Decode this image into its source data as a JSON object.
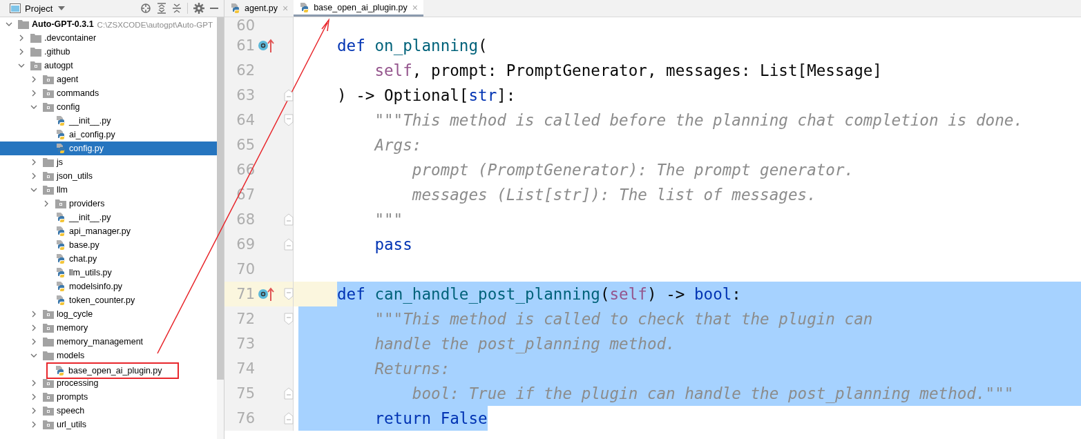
{
  "sidebar": {
    "title": "Project",
    "tree": [
      {
        "kind": "folder",
        "name": "Auto-GPT-0.3.1",
        "path": "C:\\ZSXCODE\\autogpt\\Auto-GPT",
        "expanded": true,
        "selected": false,
        "children": [
          {
            "kind": "folder",
            "name": ".devcontainer",
            "expanded": false,
            "selected": false
          },
          {
            "kind": "folder",
            "name": ".github",
            "expanded": false,
            "selected": false
          },
          {
            "kind": "package",
            "name": "autogpt",
            "expanded": true,
            "selected": false,
            "children": [
              {
                "kind": "package",
                "name": "agent",
                "expanded": false,
                "selected": false
              },
              {
                "kind": "package",
                "name": "commands",
                "expanded": false,
                "selected": false
              },
              {
                "kind": "package",
                "name": "config",
                "expanded": true,
                "selected": false,
                "children": [
                  {
                    "kind": "python",
                    "name": "__init__.py",
                    "selected": false
                  },
                  {
                    "kind": "python",
                    "name": "ai_config.py",
                    "selected": false
                  },
                  {
                    "kind": "python",
                    "name": "config.py",
                    "selected": true
                  }
                ]
              },
              {
                "kind": "folder",
                "name": "js",
                "expanded": false,
                "selected": false
              },
              {
                "kind": "package",
                "name": "json_utils",
                "expanded": false,
                "selected": false
              },
              {
                "kind": "package",
                "name": "llm",
                "expanded": true,
                "selected": false,
                "children": [
                  {
                    "kind": "package",
                    "name": "providers",
                    "expanded": false,
                    "selected": false
                  },
                  {
                    "kind": "python",
                    "name": "__init__.py",
                    "selected": false
                  },
                  {
                    "kind": "python",
                    "name": "api_manager.py",
                    "selected": false
                  },
                  {
                    "kind": "python",
                    "name": "base.py",
                    "selected": false
                  },
                  {
                    "kind": "python",
                    "name": "chat.py",
                    "selected": false
                  },
                  {
                    "kind": "python",
                    "name": "llm_utils.py",
                    "selected": false
                  },
                  {
                    "kind": "python",
                    "name": "modelsinfo.py",
                    "selected": false
                  },
                  {
                    "kind": "python",
                    "name": "token_counter.py",
                    "selected": false
                  }
                ]
              },
              {
                "kind": "package",
                "name": "log_cycle",
                "expanded": false,
                "selected": false
              },
              {
                "kind": "package",
                "name": "memory",
                "expanded": false,
                "selected": false
              },
              {
                "kind": "folder",
                "name": "memory_management",
                "expanded": false,
                "selected": false
              },
              {
                "kind": "folder",
                "name": "models",
                "expanded": true,
                "selected": false,
                "children": [
                  {
                    "kind": "python",
                    "name": "base_open_ai_plugin.py",
                    "selected": false,
                    "boxed": true
                  }
                ]
              },
              {
                "kind": "package",
                "name": "processing",
                "expanded": false,
                "selected": false
              },
              {
                "kind": "package",
                "name": "prompts",
                "expanded": false,
                "selected": false
              },
              {
                "kind": "package",
                "name": "speech",
                "expanded": false,
                "selected": false
              },
              {
                "kind": "package",
                "name": "url_utils",
                "expanded": false,
                "selected": false
              }
            ]
          }
        ]
      }
    ]
  },
  "tabs": [
    {
      "label": "agent.py",
      "close": "×",
      "selected": false
    },
    {
      "label": "base_open_ai_plugin.py",
      "close": "×",
      "selected": true
    }
  ],
  "annotation_arrow": true,
  "editor": {
    "lines": [
      {
        "number": "60",
        "selected": false,
        "current": false,
        "override": false,
        "fold_start": false,
        "fold_end": false
      },
      {
        "number": "61",
        "selected": false,
        "current": false,
        "override": true,
        "fold_start": false,
        "fold_end": false,
        "tokens": [
          {
            "kind": "kw",
            "text": "def "
          },
          {
            "kind": "fn",
            "text": "on_planning"
          },
          {
            "kind": "plain",
            "text": "("
          }
        ]
      },
      {
        "number": "62",
        "selected": false,
        "current": false,
        "override": false,
        "fold_start": false,
        "fold_end": false,
        "tokens": [
          {
            "kind": "self",
            "text": "    self"
          },
          {
            "kind": "plain",
            "text": ", prompt: PromptGenerator, messages: List[Message]"
          }
        ]
      },
      {
        "number": "63",
        "selected": false,
        "current": false,
        "override": false,
        "fold_start": false,
        "fold_end": true,
        "tokens": [
          {
            "kind": "plain",
            "text": ") -> Optional["
          },
          {
            "kind": "builtin",
            "text": "str"
          },
          {
            "kind": "plain",
            "text": "]:"
          }
        ]
      },
      {
        "number": "64",
        "selected": false,
        "current": false,
        "override": false,
        "fold_start": true,
        "fold_end": false,
        "tokens": [
          {
            "kind": "doc",
            "text": "    \"\"\"This method is called before the planning chat completion is done."
          }
        ]
      },
      {
        "number": "65",
        "selected": false,
        "current": false,
        "override": false,
        "fold_start": false,
        "fold_end": false,
        "tokens": [
          {
            "kind": "doc",
            "text": "    Args:"
          }
        ]
      },
      {
        "number": "66",
        "selected": false,
        "current": false,
        "override": false,
        "fold_start": false,
        "fold_end": false,
        "tokens": [
          {
            "kind": "doc",
            "text": "        prompt (PromptGenerator): The prompt generator."
          }
        ]
      },
      {
        "number": "67",
        "selected": false,
        "current": false,
        "override": false,
        "fold_start": false,
        "fold_end": false,
        "tokens": [
          {
            "kind": "doc",
            "text": "        messages (List[str]): The list of messages."
          }
        ]
      },
      {
        "number": "68",
        "selected": false,
        "current": false,
        "override": false,
        "fold_start": false,
        "fold_end": true,
        "tokens": [
          {
            "kind": "doc",
            "text": "    \"\"\""
          }
        ]
      },
      {
        "number": "69",
        "selected": false,
        "current": false,
        "override": false,
        "fold_start": false,
        "fold_end": true,
        "tokens": [
          {
            "kind": "kw",
            "text": "    pass"
          }
        ]
      },
      {
        "number": "70",
        "selected": false,
        "current": false,
        "override": false,
        "fold_start": false,
        "fold_end": false
      },
      {
        "number": "71",
        "selected": true,
        "current": true,
        "override": true,
        "fold_start": true,
        "fold_end": false,
        "tokens": [
          {
            "kind": "kw",
            "text": "def "
          },
          {
            "kind": "fn",
            "text": "can_handle_post_planning"
          },
          {
            "kind": "plain",
            "text": "("
          },
          {
            "kind": "self",
            "text": "self"
          },
          {
            "kind": "plain",
            "text": ") -> "
          },
          {
            "kind": "builtin",
            "text": "bool"
          },
          {
            "kind": "plain",
            "text": ":"
          }
        ]
      },
      {
        "number": "72",
        "selected": true,
        "current": false,
        "override": false,
        "fold_start": true,
        "fold_end": false,
        "tokens": [
          {
            "kind": "doc",
            "text": "    \"\"\"This method is called to check that the plugin can"
          }
        ]
      },
      {
        "number": "73",
        "selected": true,
        "current": false,
        "override": false,
        "fold_start": false,
        "fold_end": false,
        "tokens": [
          {
            "kind": "doc",
            "text": "    handle the post_planning method."
          }
        ]
      },
      {
        "number": "74",
        "selected": true,
        "current": false,
        "override": false,
        "fold_start": false,
        "fold_end": false,
        "tokens": [
          {
            "kind": "doc",
            "text": "    Returns:"
          }
        ]
      },
      {
        "number": "75",
        "selected": true,
        "current": false,
        "override": false,
        "fold_start": false,
        "fold_end": true,
        "tokens": [
          {
            "kind": "doc",
            "text": "        bool: True if the plugin can handle the post_planning method.\"\"\""
          }
        ]
      },
      {
        "number": "76",
        "selected": true,
        "current": false,
        "override": false,
        "fold_start": false,
        "fold_end": true,
        "tokens": [
          {
            "kind": "kw",
            "text": "    return False"
          }
        ]
      }
    ]
  }
}
